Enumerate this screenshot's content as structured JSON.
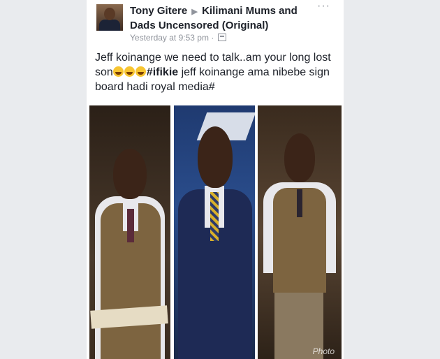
{
  "post": {
    "author": "Tony Gitere",
    "group": "Kilimani Mums and Dads Uncensored (Original)",
    "timestamp": "Yesterday at 9:53 pm",
    "separator": "·",
    "text_part1": "Jeff koinange we need to talk..am your long lost son",
    "hashtag": "#ifikie",
    "text_part2": " jeff koinange ama nibebe sign board hadi royal  media#",
    "more_icon": "more-options-icon",
    "privacy_icon": "group-privacy-icon"
  },
  "photos": {
    "watermark": "Photo"
  },
  "colors": {
    "background": "#e9ebee",
    "name_text": "#1d2129",
    "meta_text": "#90949c"
  }
}
